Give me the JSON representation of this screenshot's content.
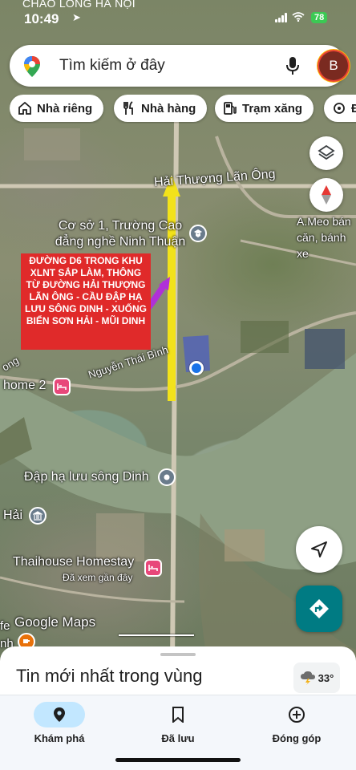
{
  "status": {
    "carrier": "CHÀO LONG HÀ NỘI",
    "time": "10:49",
    "battery": "78"
  },
  "search": {
    "placeholder": "Tìm kiếm ở đây",
    "avatar_letter": "B"
  },
  "chips": [
    {
      "label": "Nhà riêng",
      "icon": "home-icon"
    },
    {
      "label": "Nhà hàng",
      "icon": "restaurant-icon"
    },
    {
      "label": "Trạm xăng",
      "icon": "gas-station-icon"
    },
    {
      "label": "Đ",
      "icon": "museum-icon"
    }
  ],
  "map": {
    "labels": {
      "road_hai_thuong": "Hải Thượng Lãn Ông",
      "school": "Cơ sở 1, Trường Cao đẳng nghề Ninh Thuận",
      "shop": "A.Meo bán căn, bánh xe",
      "road_nguyen_thai_binh": "Nguyễn Thái Bình",
      "road_fragment": "ong",
      "home2": "home 2",
      "dam": "Đập hạ lưu sông Dinh",
      "hai": "Hải",
      "homestay": "Thaihouse Homestay",
      "homestay_sub": "Đã xem gần đây",
      "fe": "fe",
      "nh": "nh",
      "watermark": "Google Maps"
    },
    "annotation": "Đường D6 trong khu XLNT sắp làm, thông từ đường Hải Thượng Lãn Ông - cầu đập hạ lưu sông Dinh - xuống biển Sơn Hải - Mũi Dinh",
    "colors": {
      "annotation_bg": "#e02a2a",
      "yellow_route": "#f2e21b",
      "purple_route": "#b030d8",
      "location_dot": "#1a73e8",
      "hotel_pin": "#e8477a",
      "poi_gray": "#6a7c8c"
    }
  },
  "sheet": {
    "title": "Tin mới nhất trong vùng",
    "weather": "33°"
  },
  "nav": [
    {
      "label": "Khám phá",
      "icon": "explore-pin-icon",
      "active": true
    },
    {
      "label": "Đã lưu",
      "icon": "bookmark-icon",
      "active": false
    },
    {
      "label": "Đóng góp",
      "icon": "add-circle-icon",
      "active": false
    }
  ]
}
